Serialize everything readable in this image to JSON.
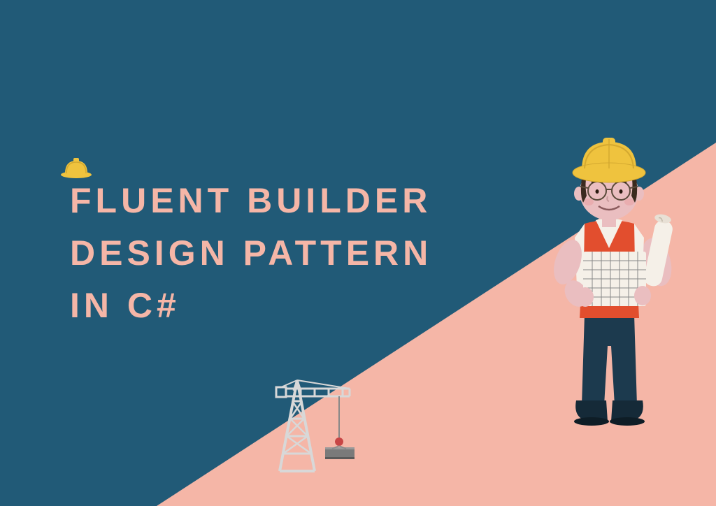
{
  "title": {
    "line1": "FLUENT BUILDER",
    "line2": "DESIGN PATTERN",
    "line3": "IN C#"
  },
  "colors": {
    "backgroundBlue": "#215A77",
    "accentPink": "#F5B6A7",
    "helmetYellow": "#EFC33E",
    "vestOrange": "#E24E2E",
    "pantsNavy": "#1C3A4E",
    "skinPink": "#EABEC0",
    "craneGray": "#D8D8D8"
  }
}
